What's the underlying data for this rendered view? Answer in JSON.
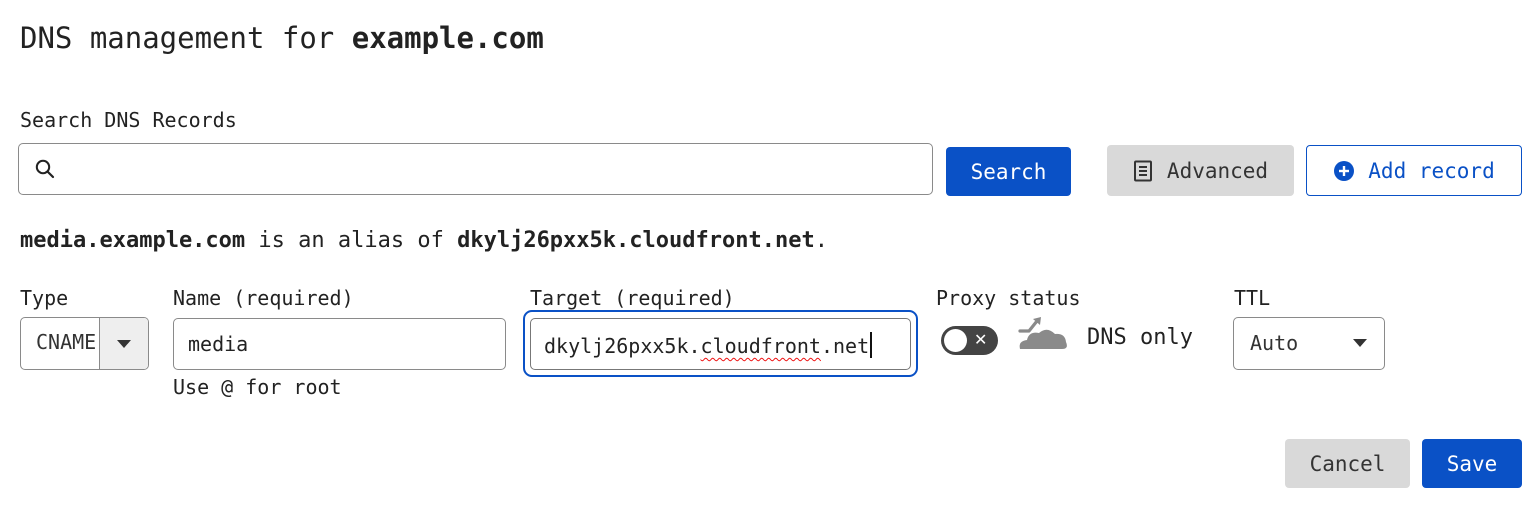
{
  "page": {
    "title_prefix": "DNS management for ",
    "title_domain": "example.com"
  },
  "search": {
    "label": "Search DNS Records",
    "value": "",
    "button": "Search"
  },
  "toolbar": {
    "advanced_label": "Advanced",
    "add_record_label": "Add record"
  },
  "alias": {
    "name": "media.example.com",
    "middle": " is an alias of ",
    "target": "dkylj26pxx5k.cloudfront.net",
    "end": "."
  },
  "form": {
    "type_label": "Type",
    "type_value": "CNAME",
    "name_label": "Name (required)",
    "name_value": "media",
    "name_help": "Use @ for root",
    "target_label": "Target (required)",
    "target_value_part1": "dkylj26pxx5k.",
    "target_value_misspelled": "cloudfront",
    "target_value_part2": ".net",
    "proxy_label": "Proxy status",
    "proxy_enabled": false,
    "proxy_value": "DNS only",
    "ttl_label": "TTL",
    "ttl_value": "Auto"
  },
  "footer": {
    "cancel_label": "Cancel",
    "save_label": "Save"
  },
  "colors": {
    "primary": "#0a51c6",
    "secondary_button": "#d9d9d9",
    "toggle_off": "#444444",
    "cloud_gray": "#888888"
  },
  "icons": [
    "search-icon",
    "document-icon",
    "plus-circle-icon",
    "chevron-down-icon",
    "close-icon",
    "cloud-icon"
  ]
}
